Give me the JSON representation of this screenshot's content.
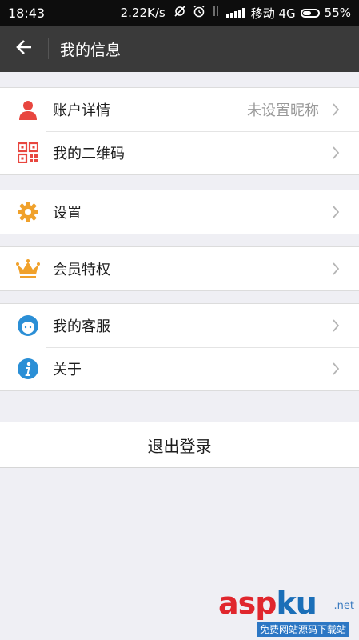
{
  "status_bar": {
    "time": "18:43",
    "speed": "2.22K/s",
    "carrier": "移动 4G",
    "battery": "55%",
    "battery_level": 0.55
  },
  "app_bar": {
    "title": "我的信息"
  },
  "menu": {
    "account": {
      "label": "账户详情",
      "value": "未设置昵称"
    },
    "qrcode": {
      "label": "我的二维码"
    },
    "settings": {
      "label": "设置"
    },
    "vip": {
      "label": "会员特权"
    },
    "service": {
      "label": "我的客服"
    },
    "about": {
      "label": "关于"
    }
  },
  "logout": {
    "label": "退出登录"
  },
  "watermark": {
    "brand_asp": "asp",
    "brand_ku": "ku",
    "domain": ".net",
    "sub": "免费网站源码下载站"
  },
  "colors": {
    "account_icon": "#e8463f",
    "qrcode_icon": "#e8463f",
    "settings_icon": "#f0a12b",
    "vip_icon": "#f0a12b",
    "service_icon": "#2b8fd6",
    "about_icon": "#2b8fd6"
  }
}
